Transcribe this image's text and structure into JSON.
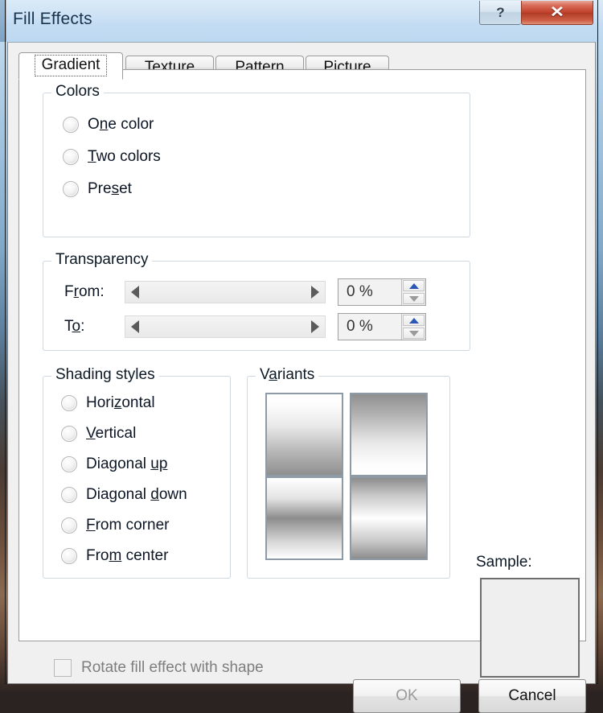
{
  "window": {
    "title": "Fill Effects",
    "help_glyph": "?",
    "close_glyph": "✕"
  },
  "tabs": [
    {
      "label": "Gradient",
      "active": true
    },
    {
      "label": "Texture",
      "active": false
    },
    {
      "label": "Pattern",
      "active": false
    },
    {
      "label": "Picture",
      "active": false
    }
  ],
  "colors_group": {
    "title": "Colors",
    "options": [
      {
        "pre": "O",
        "key": "n",
        "post": "e color",
        "selected": false
      },
      {
        "pre": "",
        "key": "T",
        "post": "wo colors",
        "selected": false
      },
      {
        "pre": "Pre",
        "key": "s",
        "post": "et",
        "selected": false
      }
    ]
  },
  "transparency_group": {
    "title": "Transparency",
    "rows": [
      {
        "pre": "F",
        "key": "r",
        "post": "om:",
        "value": "0 %"
      },
      {
        "pre": "T",
        "key": "o",
        "post": ":",
        "value": "0 %"
      }
    ]
  },
  "shading_group": {
    "title": "Shading styles",
    "options": [
      {
        "pre": "Hori",
        "key": "z",
        "post": "ontal",
        "selected": false
      },
      {
        "pre": "",
        "key": "V",
        "post": "ertical",
        "selected": false
      },
      {
        "pre": "Diagonal ",
        "key": "up",
        "post": "",
        "selected": false
      },
      {
        "pre": "Diagonal ",
        "key": "d",
        "post": "own",
        "selected": false
      },
      {
        "pre": "",
        "key": "F",
        "post": "rom corner",
        "selected": false
      },
      {
        "pre": "Fro",
        "key": "m",
        "post": " center",
        "selected": false
      }
    ]
  },
  "variants_group": {
    "title_pre": "V",
    "title_key": "a",
    "title_post": "riants",
    "items": [
      {
        "name": "variant-top-left",
        "gradient": "linear-gradient(180deg,#ffffff 0%,#fdfdfd 12%,#e8e8e8 40%,#b6b6b6 72%,#8f8f8f 100%)"
      },
      {
        "name": "variant-top-right",
        "gradient": "linear-gradient(180deg,#8f8f8f 0%,#b6b6b6 28%,#e8e8e8 60%,#fdfdfd 88%,#ffffff 100%)"
      },
      {
        "name": "variant-bottom-left",
        "gradient": "linear-gradient(180deg,#ffffff 0%,#e4e4e4 25%,#8d8d8d 50%,#d4d4d4 78%,#ffffff 100%)"
      },
      {
        "name": "variant-bottom-right",
        "gradient": "linear-gradient(180deg,#8d8d8d 0%,#c9c9c9 22%,#ffffff 50%,#c9c9c9 78%,#8d8d8d 100%)"
      }
    ]
  },
  "sample": {
    "label": "Sample:"
  },
  "rotate": {
    "label": "Rotate fill effect with shape",
    "checked": false
  },
  "footer": {
    "ok_label": "OK",
    "cancel_label": "Cancel"
  }
}
